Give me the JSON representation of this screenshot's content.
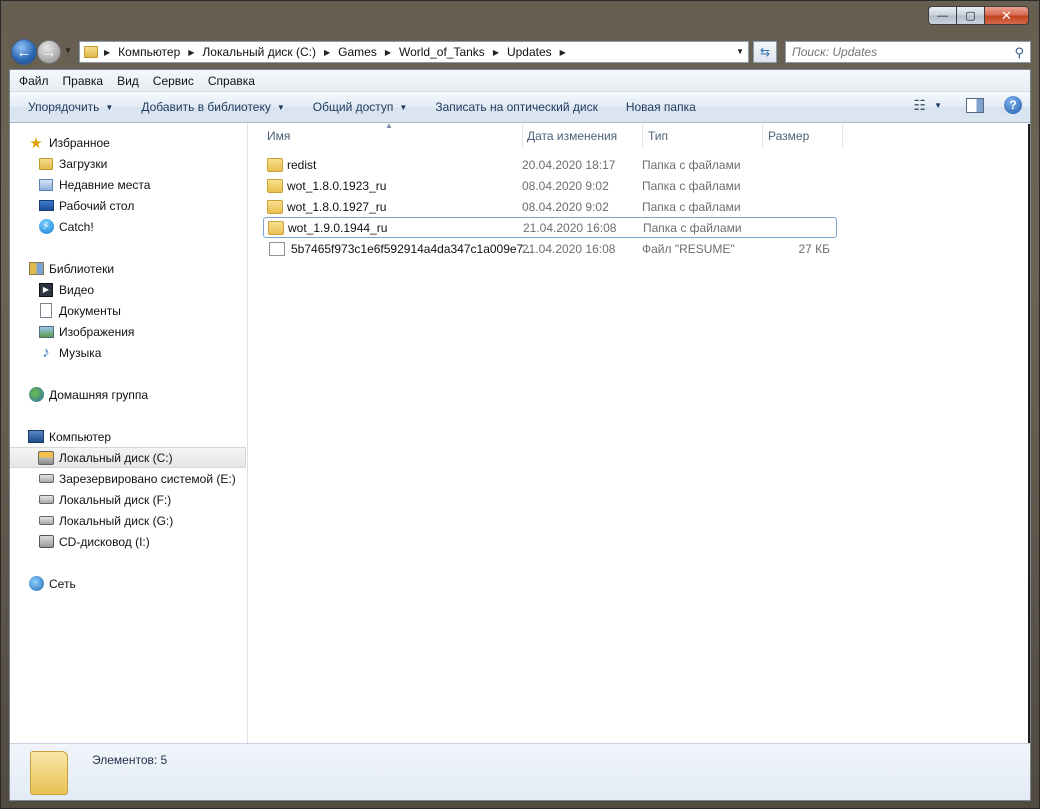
{
  "window": {
    "controls": {
      "minimize": "—",
      "maximize": "▢",
      "close": "✕"
    }
  },
  "address": {
    "crumbs": [
      "Компьютер",
      "Локальный диск (C:)",
      "Games",
      "World_of_Tanks",
      "Updates"
    ]
  },
  "search": {
    "placeholder": "Поиск: Updates"
  },
  "menu": [
    "Файл",
    "Правка",
    "Вид",
    "Сервис",
    "Справка"
  ],
  "toolbar": {
    "organize": "Упорядочить",
    "add_library": "Добавить в библиотеку",
    "share": "Общий доступ",
    "burn": "Записать на оптический диск",
    "new_folder": "Новая папка"
  },
  "navpane": {
    "favorites": "Избранное",
    "downloads": "Загрузки",
    "recent": "Недавние места",
    "desktop": "Рабочий стол",
    "catch": "Catch!",
    "libraries": "Библиотеки",
    "video": "Видео",
    "documents": "Документы",
    "images": "Изображения",
    "music": "Музыка",
    "homegroup": "Домашняя группа",
    "computer": "Компьютер",
    "drive_c": "Локальный диск (C:)",
    "drive_e": "Зарезервировано системой (E:)",
    "drive_f": "Локальный диск (F:)",
    "drive_g": "Локальный диск (G:)",
    "drive_i": "CD-дисковод (I:)",
    "network": "Сеть"
  },
  "columns": {
    "name": "Имя",
    "date": "Дата изменения",
    "type": "Тип",
    "size": "Размер"
  },
  "files": [
    {
      "name": "redist",
      "date": "20.04.2020 18:17",
      "type": "Папка с файлами",
      "size": ""
    },
    {
      "name": "wot_1.8.0.1923_ru",
      "date": "08.04.2020 9:02",
      "type": "Папка с файлами",
      "size": ""
    },
    {
      "name": "wot_1.8.0.1927_ru",
      "date": "08.04.2020 9:02",
      "type": "Папка с файлами",
      "size": ""
    },
    {
      "name": "wot_1.9.0.1944_ru",
      "date": "21.04.2020 16:08",
      "type": "Папка с файлами",
      "size": ""
    },
    {
      "name": "5b7465f973c1e6f592914a4da347c1a009e7...",
      "date": "21.04.2020 16:08",
      "type": "Файл \"RESUME\"",
      "size": "27 КБ"
    }
  ],
  "details": {
    "count": "Элементов: 5"
  }
}
